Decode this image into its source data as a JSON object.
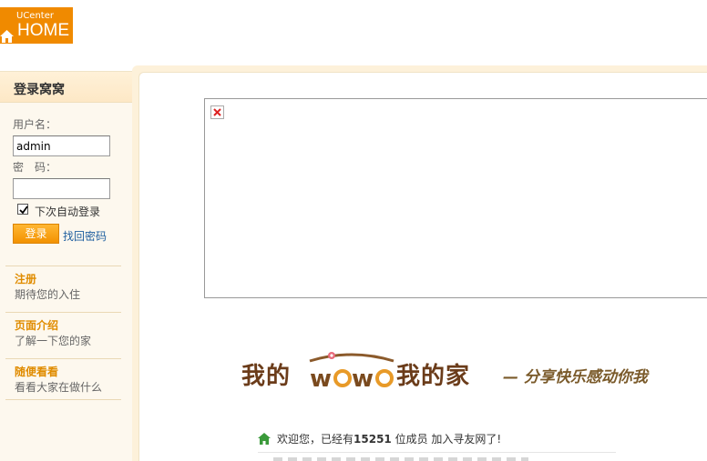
{
  "logo": {
    "top_text": "UCenter",
    "bottom_text": "HOME",
    "icon": "house-icon",
    "color": "#f08a00"
  },
  "sidebar": {
    "title": "登录窝窝",
    "username_label": "用户名：",
    "username_value": "admin",
    "password_label": "密　码：",
    "password_value": "",
    "remember_label": "下次自动登录",
    "remember_checked": true,
    "login_button": "登录",
    "forgot_link": "找回密码",
    "items": [
      {
        "title": "注册",
        "desc": "期待您的入住"
      },
      {
        "title": "页面介绍",
        "desc": "了解一下您的家"
      },
      {
        "title": "随便看看",
        "desc": "看看大家在做什么"
      }
    ],
    "accent_color": "#e08c00"
  },
  "main": {
    "broken_image_icon": "broken-image-icon",
    "banner": {
      "brand_left": "我的",
      "brand_mid": "WoWo",
      "brand_right": "我的家",
      "slogan": "— 分享快乐感动你我"
    },
    "welcome": {
      "prefix": "欢迎您，已经有",
      "count": "15251",
      "suffix": "位成员  加入寻友网了!"
    }
  }
}
